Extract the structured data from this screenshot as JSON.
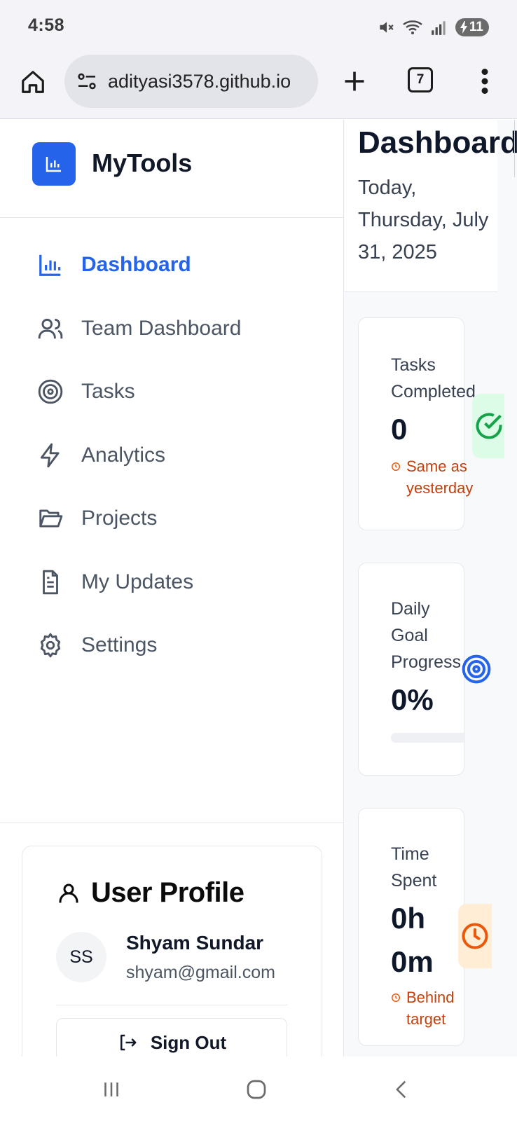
{
  "status_bar": {
    "time": "4:58",
    "battery": "11"
  },
  "browser": {
    "url": "adityasi3578.github.io",
    "tab_count": "7"
  },
  "sidebar": {
    "brand": "MyTools",
    "items": [
      {
        "label": "Dashboard",
        "icon": "bar-chart-icon",
        "active": true
      },
      {
        "label": "Team Dashboard",
        "icon": "users-icon",
        "active": false
      },
      {
        "label": "Tasks",
        "icon": "target-icon",
        "active": false
      },
      {
        "label": "Analytics",
        "icon": "zap-icon",
        "active": false
      },
      {
        "label": "Projects",
        "icon": "folder-open-icon",
        "active": false
      },
      {
        "label": "My Updates",
        "icon": "file-text-icon",
        "active": false
      },
      {
        "label": "Settings",
        "icon": "gear-icon",
        "active": false
      }
    ],
    "profile": {
      "title": "User Profile",
      "initials": "SS",
      "name": "Shyam Sundar",
      "email": "shyam@gmail.com",
      "sign_out_label": "Sign Out"
    }
  },
  "main": {
    "title": "Dashboard",
    "date": "Today, Thursday, July 31, 2025",
    "cards": [
      {
        "label_lines": [
          "Tasks",
          "Completed"
        ],
        "value": "0",
        "note_lines": [
          "Same as",
          "yesterday"
        ],
        "icon": "check-circle-icon"
      },
      {
        "label_lines": [
          "Daily",
          "Goal",
          "Progress"
        ],
        "value": "0%",
        "progress": 0,
        "icon": "target-icon"
      },
      {
        "label_lines": [
          "Time",
          "Spent"
        ],
        "value_lines": [
          "0h",
          "0m"
        ],
        "note_lines": [
          "Behind",
          "target"
        ],
        "icon": "clock-icon"
      }
    ]
  },
  "colors": {
    "accent": "#2563eb",
    "success": "#16a34a",
    "warning": "#ea580c",
    "note": "#c2410c"
  }
}
